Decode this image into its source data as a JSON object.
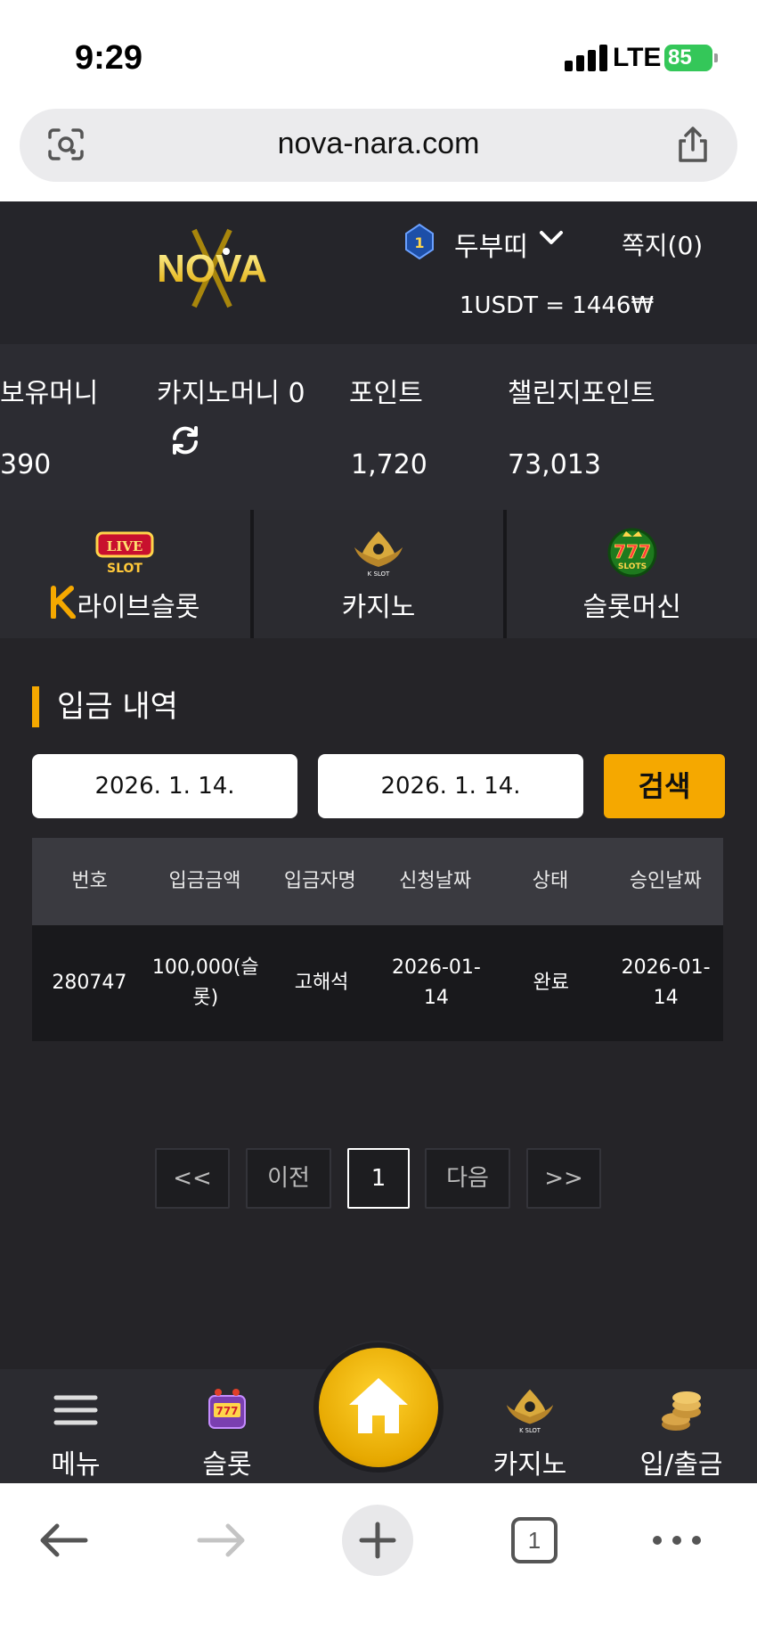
{
  "status_bar": {
    "time": "9:29",
    "network": "LTE",
    "battery": "85"
  },
  "browser": {
    "url": "nova-nara.com",
    "tab_count": "1"
  },
  "header": {
    "logo_text": "NOVA",
    "username": "두부띠",
    "messages": "쪽지(0)",
    "exchange_rate": "1USDT = 1446₩"
  },
  "balance": {
    "held_money_label": "보유머니",
    "held_money_value": "390",
    "casino_money_label": "카지노머니 0",
    "points_label": "포인트",
    "points_value": "1,720",
    "challenge_points_label": "챌린지포인트",
    "challenge_points_value": "73,013"
  },
  "game_tabs": [
    {
      "label": "라이브슬롯",
      "icon": "live-slot-icon"
    },
    {
      "label": "카지노",
      "icon": "k-slot-icon"
    },
    {
      "label": "슬롯머신",
      "icon": "777-slots-icon"
    }
  ],
  "section": {
    "title": "입금 내역"
  },
  "filters": {
    "start_date": "2026. 1. 14.",
    "end_date": "2026. 1. 14.",
    "search_label": "검색"
  },
  "table": {
    "headers": [
      "번호",
      "입금금액",
      "입금자명",
      "신청날짜",
      "상태",
      "승인날짜"
    ],
    "rows": [
      [
        "280747",
        "100,000(슬롯)",
        "고해석",
        "2026-01-14",
        "완료",
        "2026-01-14"
      ]
    ]
  },
  "pagination": {
    "first": "<<",
    "prev": "이전",
    "current": "1",
    "next": "다음",
    "last": ">>"
  },
  "bottom_nav": {
    "menu": "메뉴",
    "slot": "슬롯",
    "casino": "카지노",
    "deposit": "입/출금"
  },
  "colors": {
    "accent": "#f5a800",
    "background": "#252428",
    "header": "#25252a"
  }
}
